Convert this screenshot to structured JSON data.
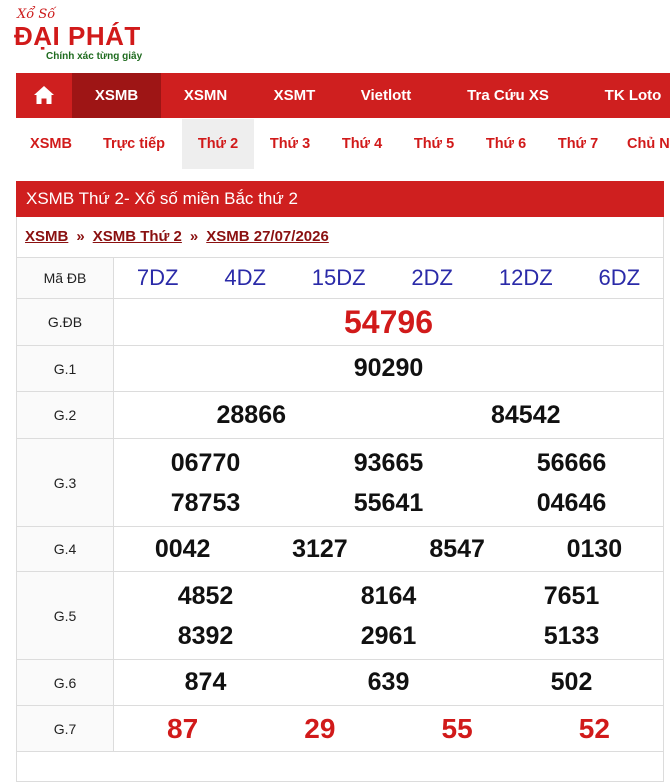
{
  "logo": {
    "small": "Xổ Số",
    "main": "ĐẠI PHÁT",
    "tagline": "Chính xác từng giây"
  },
  "main_nav": {
    "home_icon": "home-icon",
    "items": [
      "XSMB",
      "XSMN",
      "XSMT",
      "Vietlott",
      "Tra Cứu XS",
      "TK Loto"
    ],
    "active": "XSMB"
  },
  "sub_nav": {
    "items": [
      "XSMB",
      "Trực tiếp",
      "Thứ 2",
      "Thứ 3",
      "Thứ 4",
      "Thứ 5",
      "Thứ 6",
      "Thứ 7",
      "Chủ Nhật"
    ],
    "active": "Thứ 2"
  },
  "result": {
    "title": "XSMB Thứ 2- Xổ số miền Bắc thứ 2",
    "breadcrumb": [
      "XSMB",
      "XSMB Thứ 2",
      "XSMB 27/07/2026"
    ],
    "breadcrumb_sep": "»",
    "ma_db_label": "Mã ĐB",
    "ma_db": [
      "7DZ",
      "4DZ",
      "15DZ",
      "2DZ",
      "12DZ",
      "6DZ"
    ],
    "prizes": {
      "gdb": {
        "label": "G.ĐB",
        "numbers": [
          "54796"
        ]
      },
      "g1": {
        "label": "G.1",
        "numbers": [
          "90290"
        ]
      },
      "g2": {
        "label": "G.2",
        "numbers": [
          "28866",
          "84542"
        ]
      },
      "g3": {
        "label": "G.3",
        "numbers": [
          "06770",
          "93665",
          "56666",
          "78753",
          "55641",
          "04646"
        ]
      },
      "g4": {
        "label": "G.4",
        "numbers": [
          "0042",
          "3127",
          "8547",
          "0130"
        ]
      },
      "g5": {
        "label": "G.5",
        "numbers": [
          "4852",
          "8164",
          "7651",
          "8392",
          "2961",
          "5133"
        ]
      },
      "g6": {
        "label": "G.6",
        "numbers": [
          "874",
          "639",
          "502"
        ]
      },
      "g7": {
        "label": "G.7",
        "numbers": [
          "87",
          "29",
          "55",
          "52"
        ]
      }
    }
  },
  "colors": {
    "brand_red": "#cf1f1f",
    "active_nav": "#9e1515",
    "code_blue": "#2a2aa8",
    "breadcrumb": "#8a1010"
  }
}
